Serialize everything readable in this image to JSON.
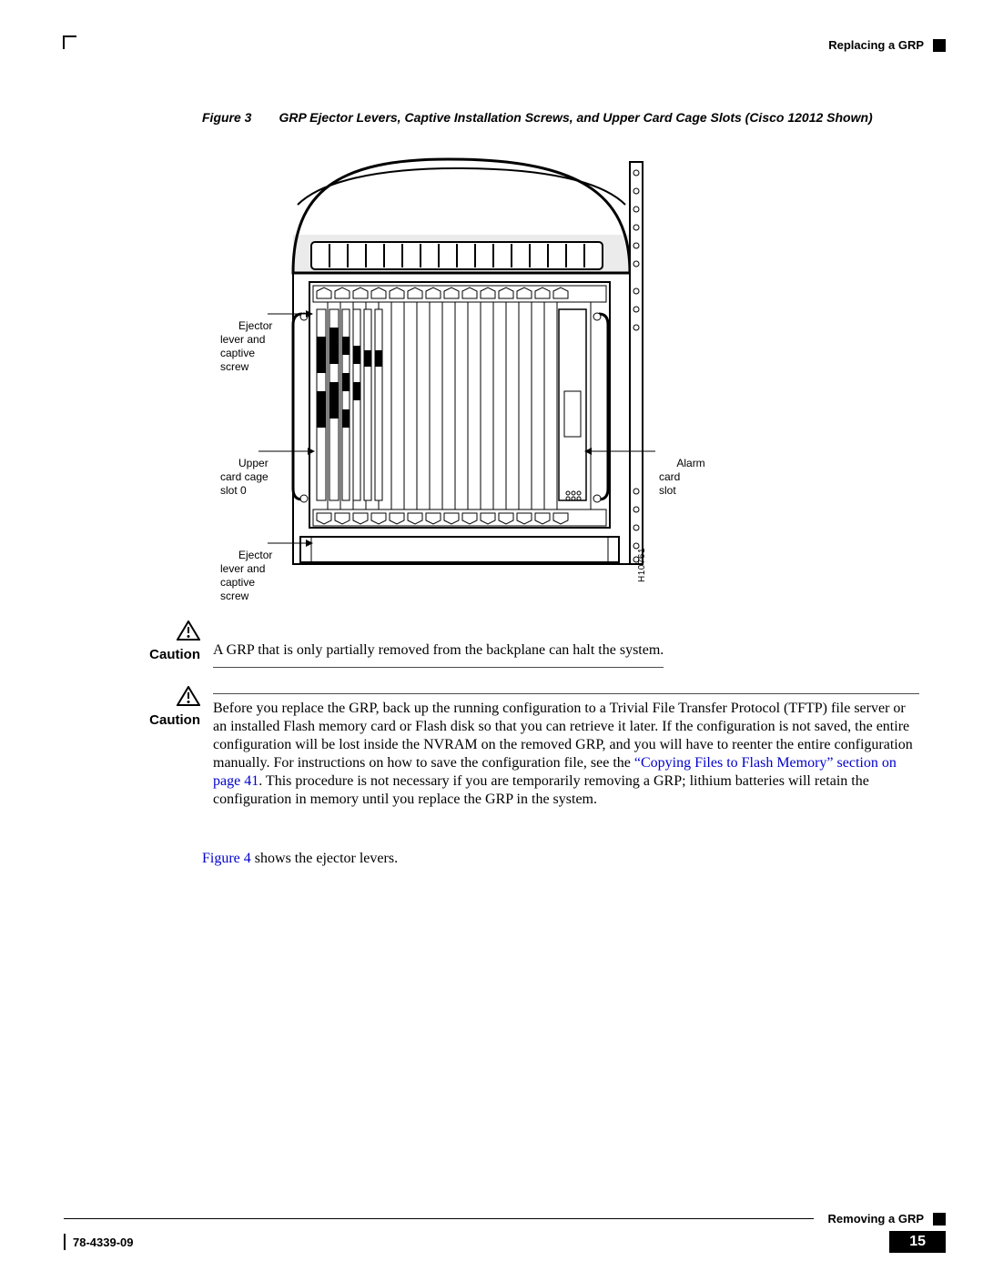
{
  "header": {
    "section": "Replacing a GRP"
  },
  "figure": {
    "label": "Figure 3",
    "title": "GRP Ejector Levers, Captive Installation Screws, and Upper Card Cage Slots (Cisco 12012 Shown)",
    "callouts": {
      "ejector_top": "Ejector\nlever and\ncaptive\nscrew",
      "upper_slot": "Upper\ncard cage\nslot 0",
      "ejector_bottom": "Ejector\nlever and\ncaptive\nscrew",
      "alarm": "Alarm\ncard\nslot"
    },
    "drawing_id": "H10761"
  },
  "caution1": {
    "label": "Caution",
    "text": "A GRP that is only partially removed from the backplane can halt the system."
  },
  "caution2": {
    "label": "Caution",
    "text_before": "Before you replace the GRP, back up the running configuration to a Trivial File Transfer Protocol (TFTP) file server or an installed Flash memory card or Flash disk so that you can retrieve it later. If the configuration is not saved, the entire configuration will be lost inside the NVRAM on the removed GRP, and you will have to reenter the entire configuration manually. For instructions on how to save the configuration file, see the ",
    "link_text": "“Copying Files to Flash Memory” section on page 41",
    "text_after": ". This procedure is not necessary if you are temporarily removing a GRP; lithium batteries will retain the configuration in memory until you replace the GRP in the system."
  },
  "body": {
    "ref_link": "Figure 4",
    "ref_rest": " shows the ejector levers."
  },
  "footer": {
    "section": "Removing a GRP",
    "docnum": "78-4339-09",
    "page": "15"
  }
}
